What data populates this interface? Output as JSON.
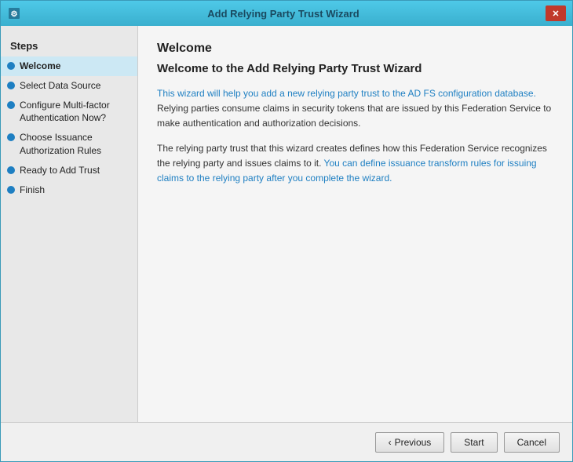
{
  "window": {
    "title": "Add Relying Party Trust Wizard",
    "icon": "🔧"
  },
  "sidebar": {
    "heading": "Steps",
    "items": [
      {
        "id": "welcome",
        "label": "Welcome",
        "active": true
      },
      {
        "id": "select-data-source",
        "label": "Select Data Source",
        "active": false
      },
      {
        "id": "configure-multifactor",
        "label": "Configure Multi-factor Authentication Now?",
        "active": false
      },
      {
        "id": "choose-issuance",
        "label": "Choose Issuance Authorization Rules",
        "active": false
      },
      {
        "id": "ready-to-add",
        "label": "Ready to Add Trust",
        "active": false
      },
      {
        "id": "finish",
        "label": "Finish",
        "active": false
      }
    ]
  },
  "main": {
    "title": "Welcome to the Add Relying Party Trust Wizard",
    "paragraph1_prefix": "This wizard will help you add a new relying party trust to the AD FS configuration database.  Relying parties consume claims in security tokens that are issued by this Federation Service to make authentication and authorization decisions.",
    "paragraph1_highlighted": "",
    "paragraph2": "The relying party trust that this wizard creates defines how this Federation Service recognizes the relying party and issues claims to it. ",
    "paragraph2_highlighted": "You can define issuance transform rules for issuing claims to the relying party after you complete the wizard.",
    "page_header": "Welcome"
  },
  "footer": {
    "previous_label": "< Previous",
    "start_label": "Start",
    "cancel_label": "Cancel"
  }
}
